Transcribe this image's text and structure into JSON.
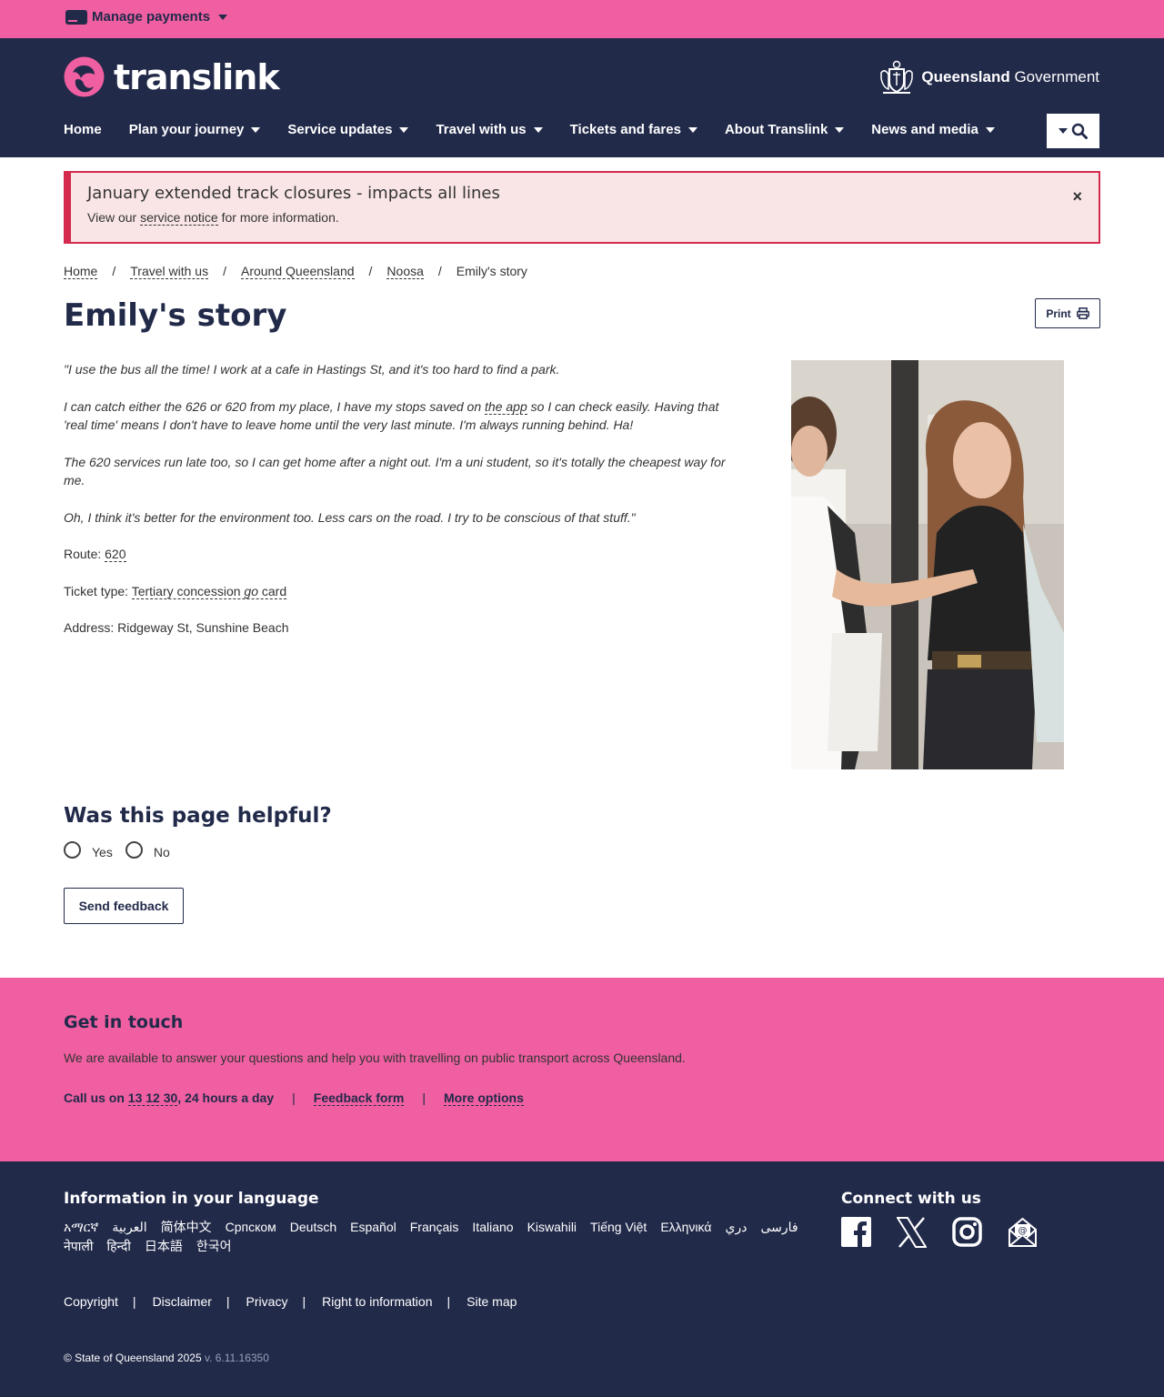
{
  "topbar": {
    "manage_payments": "Manage payments"
  },
  "header": {
    "logo_text": "translink",
    "gov_bold": "Queensland",
    "gov_regular": " Government",
    "nav": [
      "Home",
      "Plan your journey",
      "Service updates",
      "Travel with us",
      "Tickets and fares",
      "About Translink",
      "News and media"
    ]
  },
  "alert": {
    "title": "January extended track closures - impacts all lines",
    "body_prefix": "View our ",
    "body_link": "service notice",
    "body_suffix": " for more information.",
    "close": "×"
  },
  "breadcrumb": [
    "Home",
    "Travel with us",
    "Around Queensland",
    "Noosa",
    "Emily's story"
  ],
  "page": {
    "title": "Emily's story",
    "print_label": "Print"
  },
  "story": {
    "p1": "\"I use the bus all the time! I work at a cafe in Hastings St, and it's too hard to find a park.",
    "p2_prefix": "I can catch either the 626 or 620 from my place, I have my stops saved on ",
    "p2_link": "the app",
    "p2_suffix": " so I can check easily. Having that 'real time' means I don't have to leave home until the very last minute. I'm always running behind. Ha!",
    "p3": "The 620 services run late too, so I can get home after a night out. I'm a uni student, so it's totally the cheapest way for me.",
    "p4": "Oh, I think it's better for the environment too. Less cars on the road. I try to be conscious of that stuff.\"",
    "route_label": "Route: ",
    "route_value": "620",
    "ticket_label": "Ticket type: ",
    "ticket_value_1": "Tertiary concession ",
    "ticket_value_go": "go",
    "ticket_value_2": " card",
    "address": "Address: Ridgeway St, Sunshine Beach"
  },
  "feedback": {
    "heading": "Was this page helpful?",
    "yes": "Yes",
    "no": "No",
    "send": "Send feedback"
  },
  "touch": {
    "heading": "Get in touch",
    "text": "We are available to answer your questions and help you with travelling on public transport across Queensland.",
    "call_prefix": "Call us on ",
    "phone": "13 12 30",
    "call_suffix": ", 24 hours a day",
    "feedback_form": "Feedback form",
    "more_options": "More options",
    "sep": "|"
  },
  "footer": {
    "lang_heading": "Information in your language",
    "languages": [
      "አማርኛ",
      "العربية",
      "简体中文",
      "Српском",
      "Deutsch",
      "Español",
      "Français",
      "Italiano",
      "Kiswahili",
      "Tiếng Việt",
      "Ελληνικά",
      "دري",
      "فارسی",
      "नेपाली",
      "हिन्दी",
      "日本語",
      "한국어"
    ],
    "connect_heading": "Connect with us",
    "social_icons": [
      "facebook-icon",
      "x-icon",
      "instagram-icon",
      "email-icon"
    ],
    "legal": [
      "Copyright",
      "Disclaimer",
      "Privacy",
      "Right to information",
      "Site map"
    ],
    "copyright": "© State of Queensland 2025",
    "version": " v. 6.11.16350"
  },
  "colors": {
    "pink": "#ef5fa1",
    "navy": "#222a4a",
    "alert_bg": "#f9e5e6",
    "alert_border": "#d42a4e"
  }
}
